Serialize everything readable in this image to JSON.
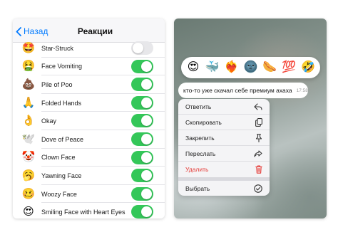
{
  "nav": {
    "back_label": "Назад",
    "title": "Реакции"
  },
  "reactions_list": [
    {
      "emoji": "🤩",
      "label": "Star-Struck",
      "enabled": false
    },
    {
      "emoji": "🤮",
      "label": "Face Vomiting",
      "enabled": true
    },
    {
      "emoji": "💩",
      "label": "Pile of Poo",
      "enabled": true
    },
    {
      "emoji": "🙏",
      "label": "Folded Hands",
      "enabled": true
    },
    {
      "emoji": "👌",
      "label": "Okay",
      "enabled": true
    },
    {
      "emoji": "🕊️",
      "label": "Dove of Peace",
      "enabled": true
    },
    {
      "emoji": "🤡",
      "label": "Clown Face",
      "enabled": true
    },
    {
      "emoji": "🥱",
      "label": "Yawning Face",
      "enabled": true
    },
    {
      "emoji": "🥴",
      "label": "Woozy Face",
      "enabled": true
    },
    {
      "emoji": "😍",
      "label": "Smiling Face with Heart Eyes",
      "enabled": true
    }
  ],
  "reaction_bar": [
    "😍",
    "🐳",
    "❤️‍🔥",
    "🌚",
    "🌭",
    "💯",
    "🤣"
  ],
  "message": {
    "text": "кто-то уже скачал себе премиум ахаха",
    "time": "17:58"
  },
  "context_menu": [
    {
      "label": "Ответить",
      "icon": "reply-icon",
      "danger": false
    },
    {
      "label": "Скопировать",
      "icon": "copy-icon",
      "danger": false
    },
    {
      "label": "Закрепить",
      "icon": "pin-icon",
      "danger": false
    },
    {
      "label": "Переслать",
      "icon": "forward-icon",
      "danger": false
    },
    {
      "label": "Удалить",
      "icon": "trash-icon",
      "danger": true
    },
    {
      "label": "Выбрать",
      "icon": "check-circle-icon",
      "danger": false
    }
  ],
  "colors": {
    "accent": "#007aff",
    "toggle_on": "#34c759",
    "toggle_off": "#e7e7ea",
    "danger": "#e53935"
  }
}
